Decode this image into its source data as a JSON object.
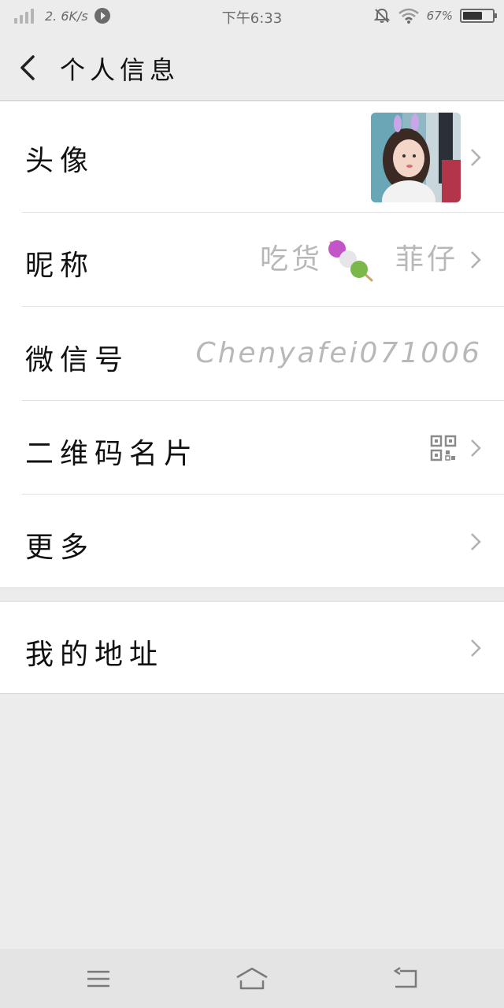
{
  "status_bar": {
    "speed": "2. 6K/s",
    "time": "下午6:33",
    "battery_text": "67%",
    "battery_level": 0.67
  },
  "nav": {
    "title": "个人信息"
  },
  "rows": {
    "avatar": {
      "label": "头像"
    },
    "nickname": {
      "label": "昵称",
      "value_prefix": "吃货",
      "value_suffix": "菲仔"
    },
    "wechat_id": {
      "label": "微信号",
      "value": "Chenyafei071006"
    },
    "qr_card": {
      "label": "二维码名片"
    },
    "more": {
      "label": "更多"
    },
    "address": {
      "label": "我的地址"
    }
  },
  "icons": {
    "back": "back-arrow-icon",
    "chevron": "chevron-right-icon",
    "qr": "qr-code-icon",
    "dango": "dango-emoji-icon",
    "menu": "menu-icon",
    "home": "home-icon",
    "return": "return-icon"
  },
  "colors": {
    "background": "#ececec",
    "card": "#ffffff",
    "text": "#111111",
    "secondary_text": "#b8b8b8",
    "chevron": "#b0b0b0"
  }
}
